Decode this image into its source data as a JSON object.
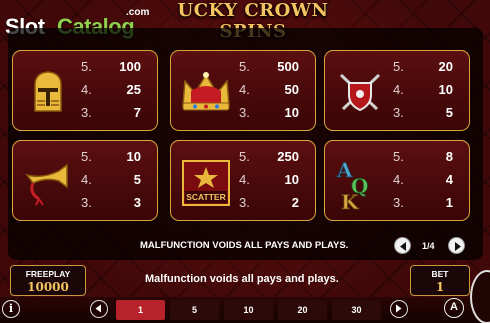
{
  "brand": {
    "slot": "Slot",
    "catalog": "Catalog",
    "com": ".com"
  },
  "title": "UCKY CROWN SPINS",
  "paytable": [
    {
      "symbol": "knight-helmet-icon",
      "pays": [
        {
          "count": "5.",
          "value": "100"
        },
        {
          "count": "4.",
          "value": "25"
        },
        {
          "count": "3.",
          "value": "7"
        }
      ]
    },
    {
      "symbol": "crown-icon",
      "pays": [
        {
          "count": "5.",
          "value": "500"
        },
        {
          "count": "4.",
          "value": "50"
        },
        {
          "count": "3.",
          "value": "10"
        }
      ]
    },
    {
      "symbol": "shield-swords-icon",
      "pays": [
        {
          "count": "5.",
          "value": "20"
        },
        {
          "count": "4.",
          "value": "10"
        },
        {
          "count": "3.",
          "value": "5"
        }
      ]
    },
    {
      "symbol": "horn-icon",
      "pays": [
        {
          "count": "5.",
          "value": "10"
        },
        {
          "count": "4.",
          "value": "5"
        },
        {
          "count": "3.",
          "value": "3"
        }
      ]
    },
    {
      "symbol": "scatter-icon",
      "label": "SCATTER",
      "pays": [
        {
          "count": "5.",
          "value": "250"
        },
        {
          "count": "4.",
          "value": "10"
        },
        {
          "count": "3.",
          "value": "2"
        }
      ]
    },
    {
      "symbol": "letters-aqk-icon",
      "letters": [
        "A",
        "Q",
        "K"
      ],
      "pays": [
        {
          "count": "5.",
          "value": "8"
        },
        {
          "count": "4.",
          "value": "4"
        },
        {
          "count": "3.",
          "value": "1"
        }
      ]
    }
  ],
  "notice_top": "MALFUNCTION VOIDS ALL PAYS AND PLAYS.",
  "pager": {
    "indicator": "1/4"
  },
  "freeplay": {
    "label": "FREEPLAY",
    "value": "10000"
  },
  "bet": {
    "label": "BET",
    "value": "1"
  },
  "notice_bottom": "Malfunction voids all pays and plays.",
  "bet_options": [
    "1",
    "5",
    "10",
    "20",
    "30"
  ],
  "info_label": "i",
  "auto_label": "A",
  "colors": {
    "gold": "#d9a53b",
    "selected": "#b8222a",
    "brand_green": "#8fd14f"
  }
}
